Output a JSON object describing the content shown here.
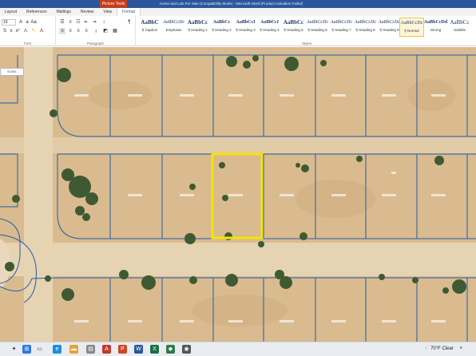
{
  "window": {
    "title": "Home and Lots For Sale (Compatibility Mode) - Microsoft Word (Product Activation Failed)",
    "context_group": "Picture Tools"
  },
  "tabs": [
    {
      "label": "Layout"
    },
    {
      "label": "References"
    },
    {
      "label": "Mailings"
    },
    {
      "label": "Review"
    },
    {
      "label": "View"
    },
    {
      "label": "Format"
    }
  ],
  "ribbon": {
    "font_size": "10",
    "groups": {
      "font": "Font",
      "paragraph": "Paragraph",
      "styles": "Styles"
    },
    "styles": [
      {
        "sample": "AaBbC",
        "name": "¶ Caption"
      },
      {
        "sample": "AaBbCcDc",
        "name": "Emphasis"
      },
      {
        "sample": "AaBbCc",
        "name": "¶ Heading 1"
      },
      {
        "sample": "AaBbCc",
        "name": "¶ Heading 2"
      },
      {
        "sample": "AaBbCcI",
        "name": "¶ Heading 3"
      },
      {
        "sample": "AaBbCcI",
        "name": "¶ Heading 4"
      },
      {
        "sample": "AaBbCc",
        "name": "¶ Heading 5"
      },
      {
        "sample": "AaBbCcDc",
        "name": "¶ Heading 6"
      },
      {
        "sample": "AaBbCcDc",
        "name": "¶ Heading 7"
      },
      {
        "sample": "AaBbCcDc",
        "name": "¶ Heading 8"
      },
      {
        "sample": "AaBbCcDc",
        "name": "¶ Heading 9"
      },
      {
        "sample": "AaBbCcDc",
        "name": "¶ Normal"
      },
      {
        "sample": "AaBbCcDd",
        "name": "Strong"
      },
      {
        "sample": "AaBbCc",
        "name": "Subtitle"
      }
    ],
    "selected_style": "¶ Normal"
  },
  "map": {
    "popup_text": "50366...",
    "highlight_color": "#f5e500",
    "line_color": "#1f5ea8"
  },
  "taskbar": {
    "weather": "70°F Clear"
  },
  "colors": {
    "title_bar": "#2b579a",
    "picture_tools": "#c43e1c",
    "sand": "#d8b98d"
  }
}
